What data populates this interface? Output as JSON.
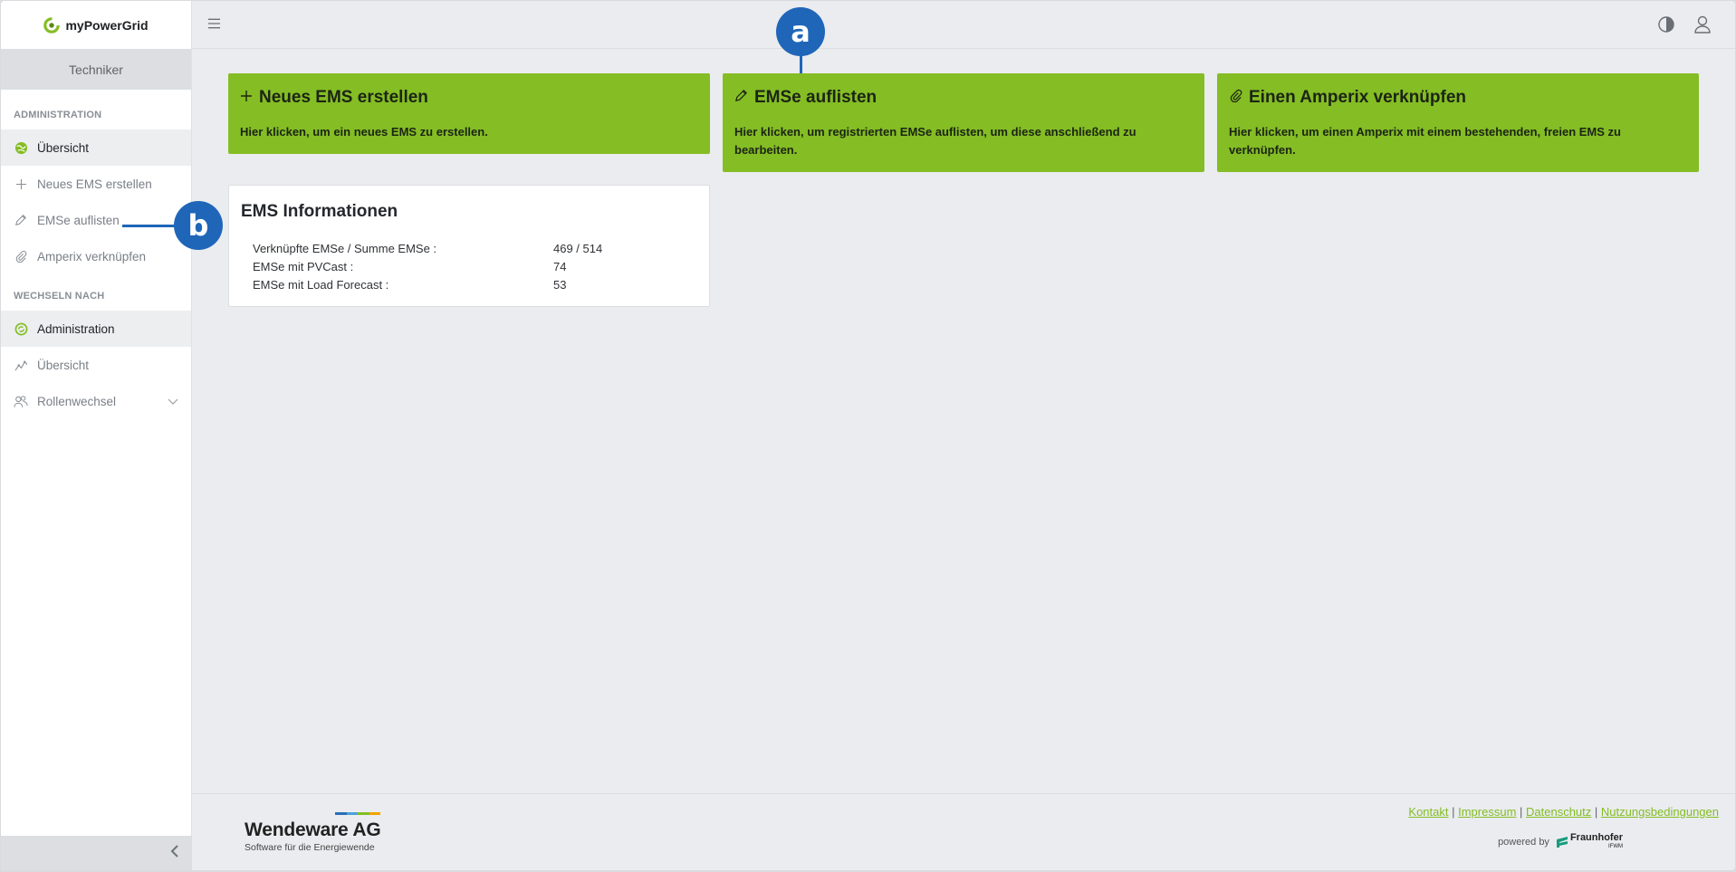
{
  "brand": {
    "name": "myPowerGrid"
  },
  "sidebar": {
    "role": "Techniker",
    "section_admin": "ADMINISTRATION",
    "admin_items": [
      {
        "label": "Übersicht",
        "icon": "globe-icon"
      },
      {
        "label": "Neues EMS erstellen",
        "icon": "plus-icon"
      },
      {
        "label": "EMSe auflisten",
        "icon": "pencil-icon"
      },
      {
        "label": "Amperix verknüpfen",
        "icon": "paperclip-icon"
      }
    ],
    "section_switch": "WECHSELN NACH",
    "switch_items": [
      {
        "label": "Administration",
        "icon": "admin-icon"
      },
      {
        "label": "Übersicht",
        "icon": "chart-icon"
      },
      {
        "label": "Rollenwechsel",
        "icon": "users-icon"
      }
    ]
  },
  "cards": [
    {
      "title": "Neues EMS erstellen",
      "desc": "Hier klicken, um ein neues EMS zu erstellen.",
      "icon": "plus-icon"
    },
    {
      "title": "EMSe auflisten",
      "desc": "Hier klicken, um registrierten EMSe auflisten, um diese anschließend zu bearbeiten.",
      "icon": "pencil-icon"
    },
    {
      "title": "Einen Amperix verknüpfen",
      "desc": "Hier klicken, um einen Amperix mit einem bestehenden, freien EMS zu verknüpfen.",
      "icon": "paperclip-icon"
    }
  ],
  "info": {
    "title": "EMS Informationen",
    "rows": [
      {
        "label": "Verknüpfte EMSe / Summe EMSe :",
        "value": "469 / 514"
      },
      {
        "label": "EMSe mit PVCast :",
        "value": "74"
      },
      {
        "label": "EMSe mit Load Forecast :",
        "value": "53"
      }
    ]
  },
  "footer": {
    "company": "Wendeware AG",
    "tagline": "Software für die Energiewende",
    "links": [
      "Kontakt",
      "Impressum",
      "Datenschutz",
      "Nutzungsbedingungen"
    ],
    "powered_by": "powered by",
    "partner": "Fraunhofer",
    "partner_sub": "IFWM"
  },
  "callouts": {
    "a": "a",
    "b": "b"
  },
  "colors": {
    "accent": "#84bd24",
    "callout": "#1f66b8"
  }
}
